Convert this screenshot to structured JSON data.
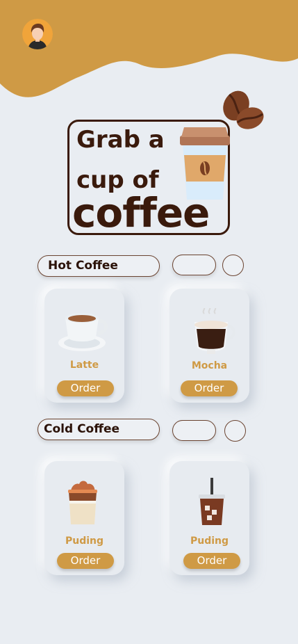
{
  "hero": {
    "line1": "Grab a",
    "line2": "cup of",
    "line3": "coffee"
  },
  "sections": [
    {
      "title": "Hot Coffee",
      "items": [
        {
          "name": "Latte",
          "button": "Order",
          "icon": "latte-cup-icon"
        },
        {
          "name": "Mocha",
          "button": "Order",
          "icon": "mocha-glass-icon"
        }
      ]
    },
    {
      "title": "Cold Coffee",
      "items": [
        {
          "name": "Puding",
          "button": "Order",
          "icon": "pudding-cup-icon"
        },
        {
          "name": "Puding",
          "button": "Order",
          "icon": "iced-coffee-icon"
        }
      ]
    }
  ],
  "colors": {
    "accent": "#cf9a45",
    "dark_brown": "#3a1a0c",
    "background": "#e9edf2"
  }
}
